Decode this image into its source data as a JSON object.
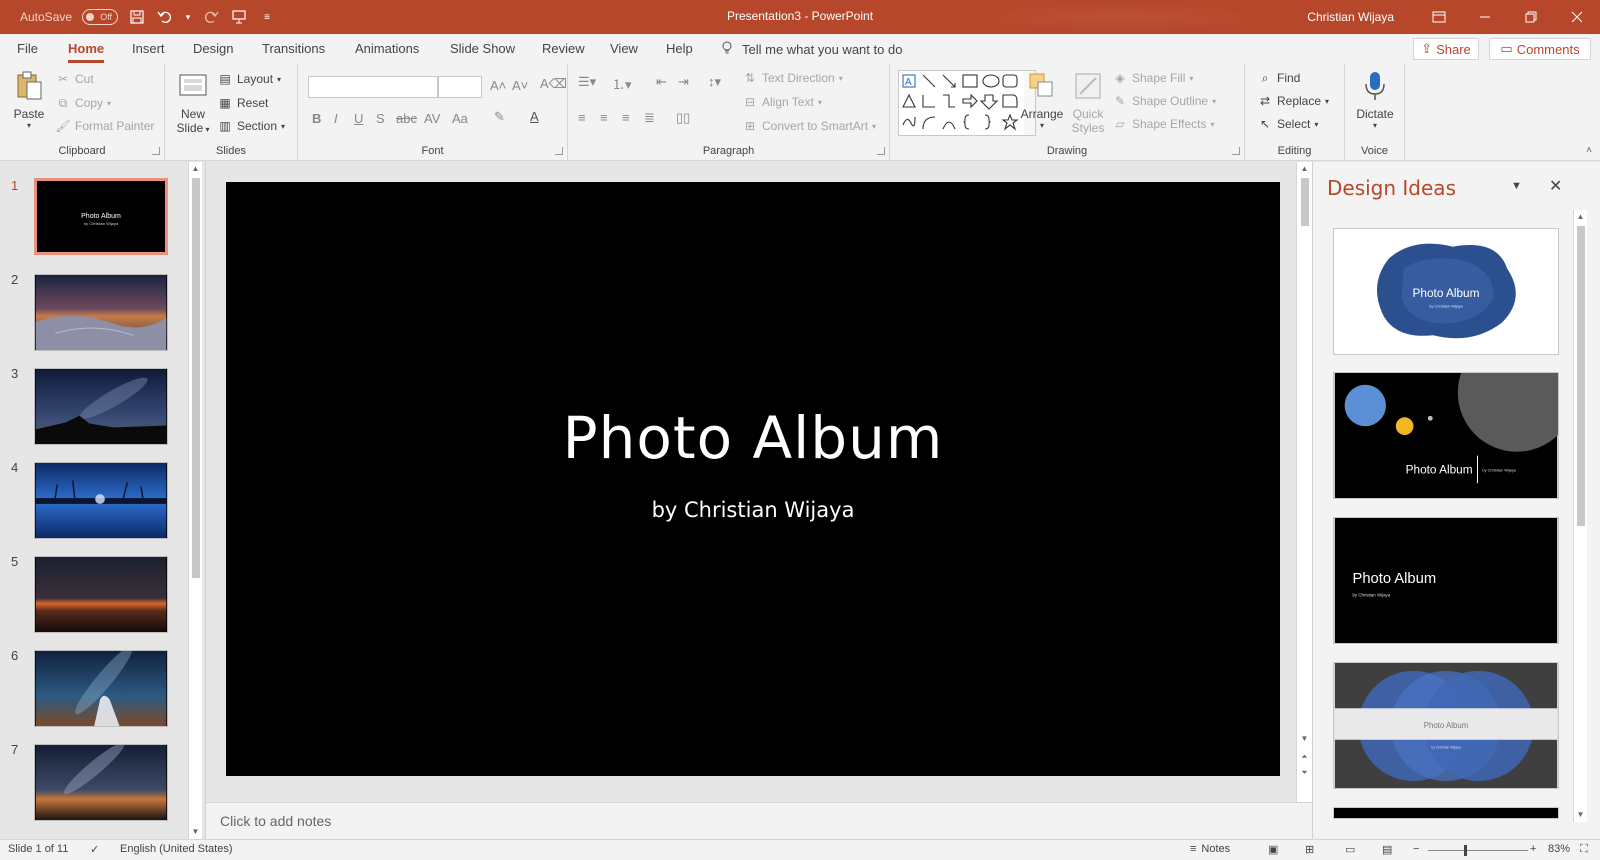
{
  "titlebar": {
    "autosave_label": "AutoSave",
    "autosave_state": "Off",
    "title": "Presentation3  -  PowerPoint",
    "user": "Christian Wijaya"
  },
  "tabs": [
    {
      "label": "File"
    },
    {
      "label": "Home"
    },
    {
      "label": "Insert"
    },
    {
      "label": "Design"
    },
    {
      "label": "Transitions"
    },
    {
      "label": "Animations"
    },
    {
      "label": "Slide Show"
    },
    {
      "label": "Review"
    },
    {
      "label": "View"
    },
    {
      "label": "Help"
    }
  ],
  "tell_me": "Tell me what you want to do",
  "share_label": "Share",
  "comments_label": "Comments",
  "ribbon": {
    "clipboard": {
      "label": "Clipboard",
      "paste": "Paste",
      "cut": "Cut",
      "copy": "Copy",
      "format_painter": "Format Painter"
    },
    "slides": {
      "label": "Slides",
      "new_slide_1": "New",
      "new_slide_2": "Slide",
      "layout": "Layout",
      "reset": "Reset",
      "section": "Section"
    },
    "font": {
      "label": "Font"
    },
    "paragraph": {
      "label": "Paragraph",
      "text_direction": "Text Direction",
      "align_text": "Align Text",
      "smartart": "Convert to SmartArt"
    },
    "drawing": {
      "label": "Drawing",
      "arrange": "Arrange",
      "quick_styles_1": "Quick",
      "quick_styles_2": "Styles",
      "shape_fill": "Shape Fill",
      "shape_outline": "Shape Outline",
      "shape_effects": "Shape Effects"
    },
    "editing": {
      "label": "Editing",
      "find": "Find",
      "replace": "Replace",
      "select": "Select"
    },
    "voice": {
      "label": "Voice",
      "dictate": "Dictate"
    }
  },
  "thumbnails": {
    "numbers": [
      "1",
      "2",
      "3",
      "4",
      "5",
      "6",
      "7"
    ],
    "slide1_title": "Photo Album",
    "slide1_subtitle": "by Christian Wijaya"
  },
  "slide": {
    "title": "Photo Album",
    "subtitle": "by Christian Wijaya"
  },
  "notes_placeholder": "Click to add notes",
  "design_ideas": {
    "title": "Design Ideas",
    "idea_title": "Photo Album",
    "idea_subtitle": "by Christian Wijaya"
  },
  "status": {
    "slide_info": "Slide 1 of 11",
    "language": "English (United States)",
    "notes": "Notes",
    "zoom": "83%"
  },
  "colors": {
    "accent": "#b7472a",
    "slide_bg": "#000000"
  }
}
